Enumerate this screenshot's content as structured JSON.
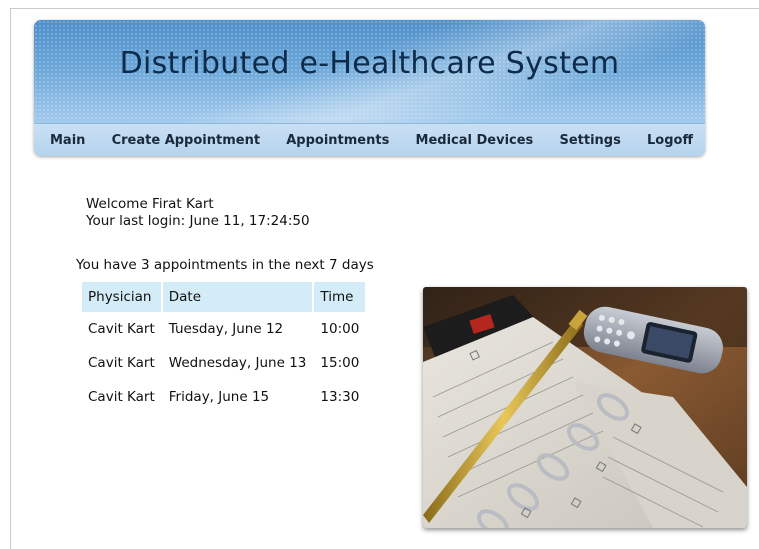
{
  "header": {
    "title": "Distributed e-Healthcare System"
  },
  "nav": {
    "items": [
      "Main",
      "Create Appointment",
      "Appointments",
      "Medical Devices",
      "Settings",
      "Logoff"
    ]
  },
  "welcome": {
    "greeting": "Welcome Firat Kart",
    "last_login": "Your last login: June 11, 17:24:50"
  },
  "appointments": {
    "summary": "You have 3 appointments in the next 7 days",
    "columns": [
      "Physician",
      "Date",
      "Time"
    ],
    "rows": [
      [
        "Cavit Kart",
        "Tuesday, June 12",
        "10:00"
      ],
      [
        "Cavit Kart",
        "Wednesday, June 13",
        "15:00"
      ],
      [
        "Cavit Kart",
        "Friday, June 15",
        "13:30"
      ]
    ]
  },
  "colors": {
    "banner_blue": "#6aa6d8",
    "nav_bar": "#c9e0f3",
    "table_header": "#d3ecf7"
  },
  "image": {
    "icon": "planner-phone-photo"
  }
}
